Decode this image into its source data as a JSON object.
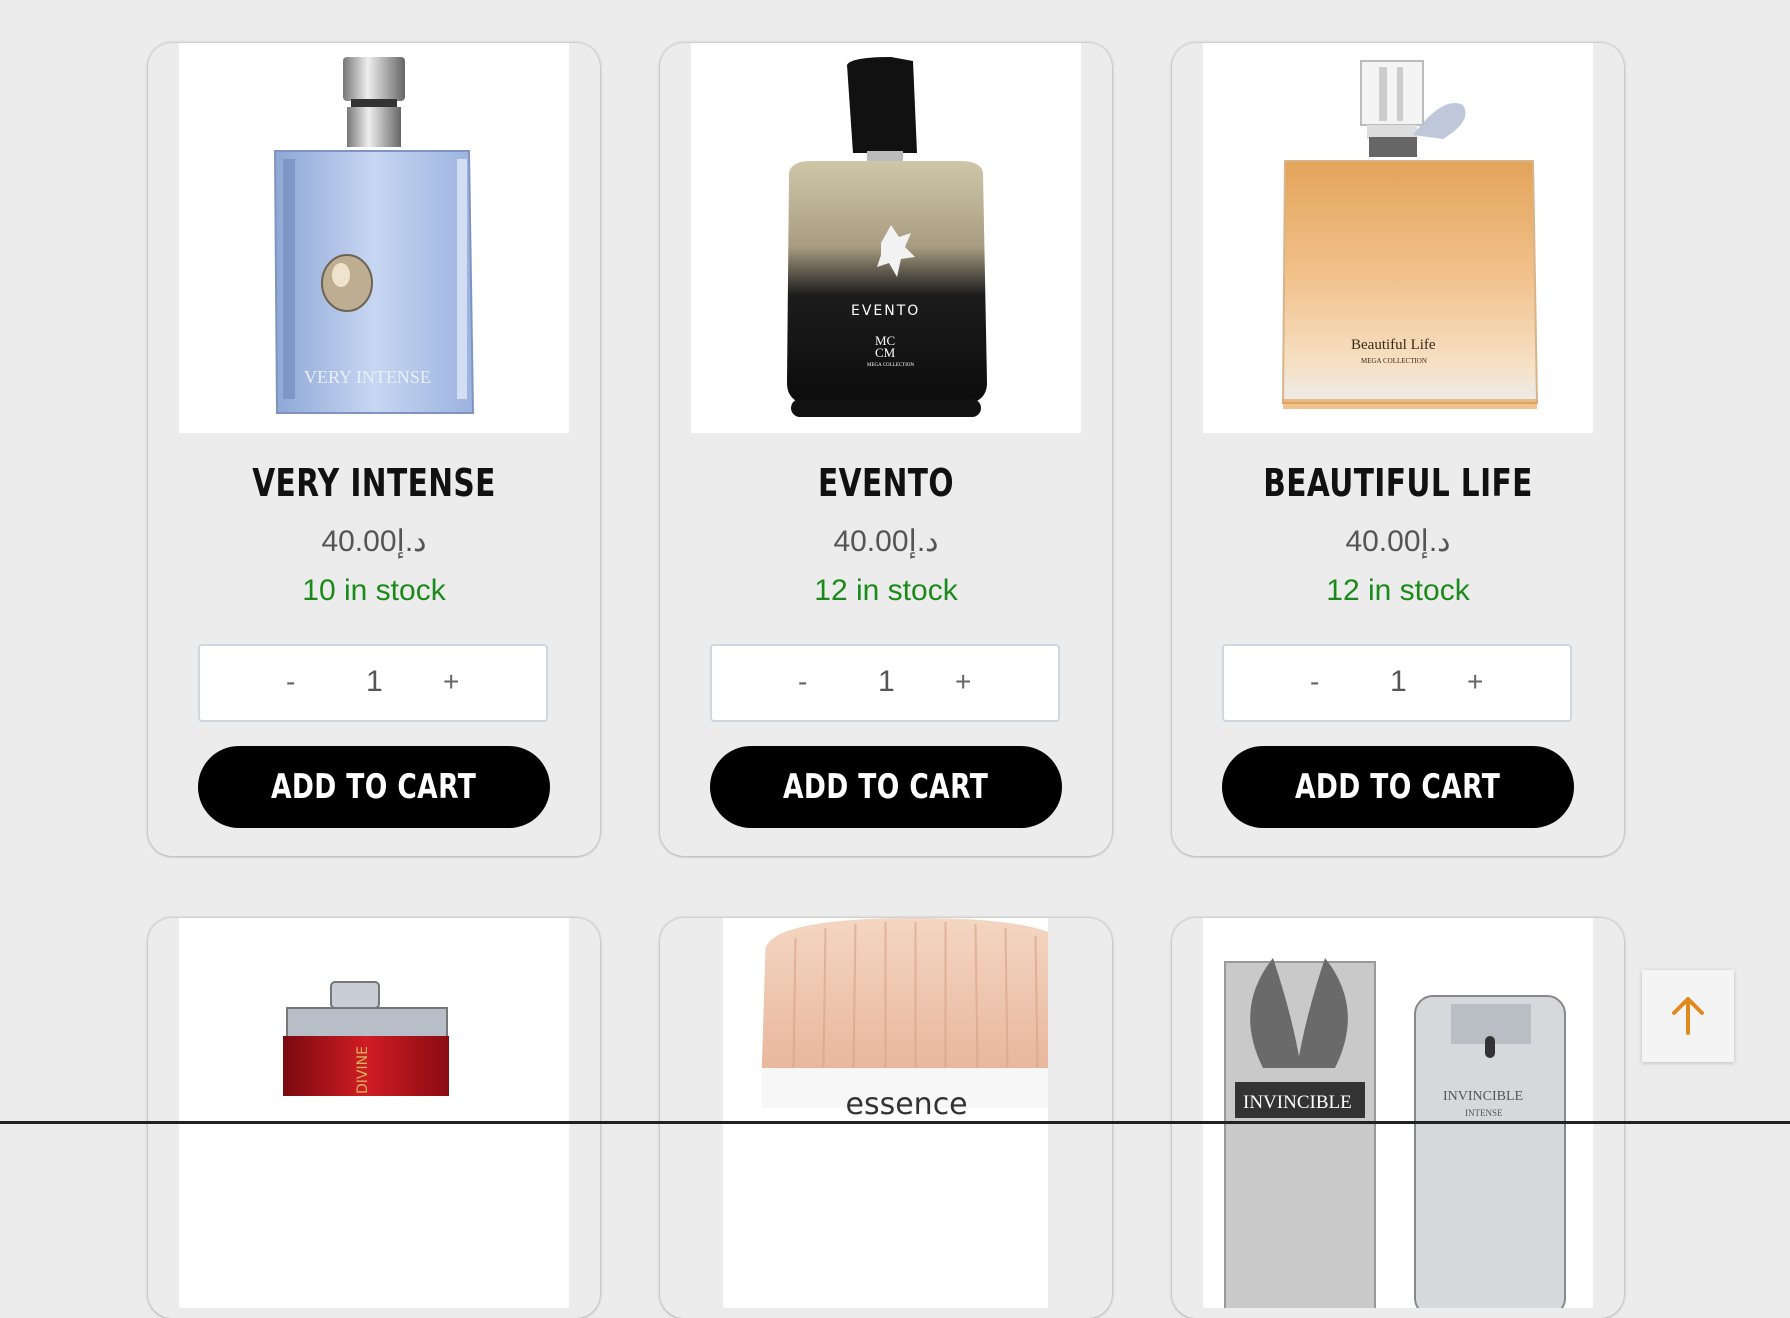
{
  "colors": {
    "background": "#ececec",
    "stock_green": "#1a8a1a",
    "button_black": "#000000",
    "scroll_arrow": "#e08a1e"
  },
  "products": [
    {
      "name": "VERY INTENSE",
      "price": "40.00د.إ",
      "stock": "10 in stock",
      "qty_minus": "-",
      "qty_value": "1",
      "qty_plus": "+",
      "cart_label": "ADD TO CART",
      "bottle_text": "VERY INTENSE"
    },
    {
      "name": "EVENTO",
      "price": "40.00د.إ",
      "stock": "12 in stock",
      "qty_minus": "-",
      "qty_value": "1",
      "qty_plus": "+",
      "cart_label": "ADD TO CART",
      "bottle_text": "EVENTO",
      "bottle_text2": "MC",
      "bottle_text3": "CM",
      "bottle_text4": "MEGA COLLECTION"
    },
    {
      "name": "BEAUTIFUL LIFE",
      "price": "40.00د.إ",
      "stock": "12 in stock",
      "qty_minus": "-",
      "qty_value": "1",
      "qty_plus": "+",
      "cart_label": "ADD TO CART",
      "bottle_text": "Beautiful Life",
      "bottle_text2": "MEGA COLLECTION"
    }
  ],
  "row2": [
    {
      "bottle_text": "DIVINE"
    },
    {
      "bottle_text": "essence"
    },
    {
      "bottle_text": "INVINCIBLE",
      "bottle_text2": "INVINCIBLE",
      "bottle_text3": "INTENSE"
    }
  ],
  "scroll_top": {
    "icon": "arrow-up-icon"
  }
}
